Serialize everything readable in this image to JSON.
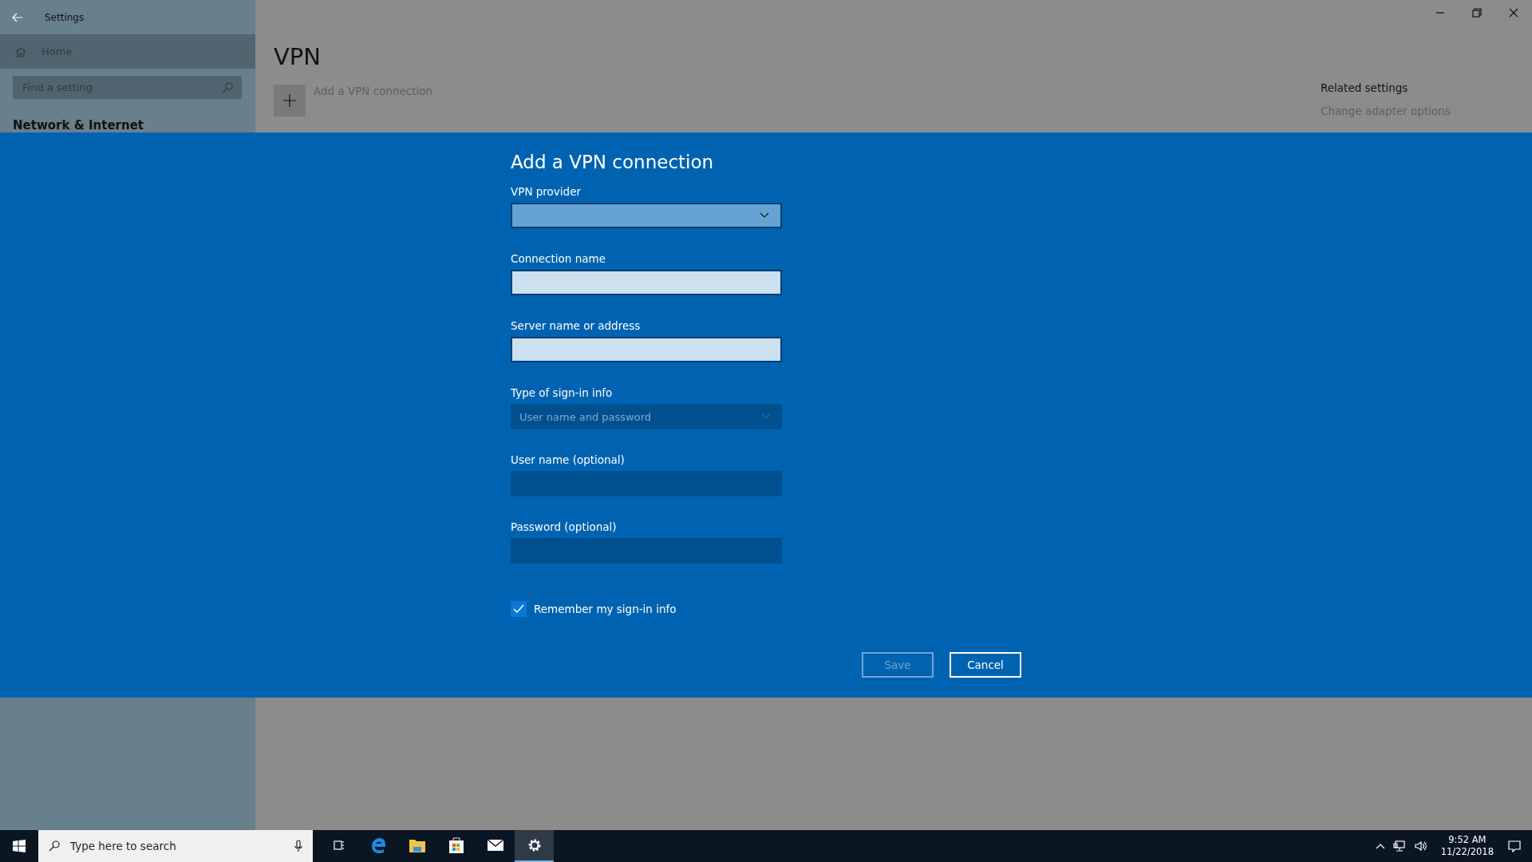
{
  "window": {
    "title": "Settings"
  },
  "sidebar": {
    "home": "Home",
    "search_placeholder": "Find a setting",
    "section": "Network & Internet"
  },
  "page": {
    "title": "VPN",
    "add_label": "Add a VPN connection",
    "related_title": "Related settings",
    "related_link": "Change adapter options"
  },
  "dialog": {
    "title": "Add a VPN connection",
    "fields": [
      {
        "kind": "dropdown",
        "label": "VPN provider",
        "disabled": false
      },
      {
        "kind": "text",
        "label": "Connection name",
        "disabled": false
      },
      {
        "kind": "text",
        "label": "Server name or address",
        "disabled": false
      },
      {
        "kind": "dropdown",
        "label": "Type of sign-in info",
        "value": "User name and password",
        "disabled": true
      },
      {
        "kind": "text",
        "label": "User name (optional)",
        "disabled": true
      },
      {
        "kind": "text",
        "label": "Password (optional)",
        "disabled": true
      }
    ],
    "remember": {
      "label": "Remember my sign-in info",
      "checked": true
    },
    "buttons": [
      {
        "label": "Save",
        "disabled": true
      },
      {
        "label": "Cancel",
        "disabled": false
      }
    ]
  },
  "taskbar": {
    "search_placeholder": "Type here to search",
    "apps": [
      {
        "kind": "taskview",
        "selected": false
      },
      {
        "kind": "edge",
        "selected": false
      },
      {
        "kind": "explorer",
        "selected": false
      },
      {
        "kind": "store",
        "selected": false
      },
      {
        "kind": "mail",
        "selected": false
      },
      {
        "kind": "settings",
        "selected": true
      }
    ],
    "time": "9:52 AM",
    "date": "11/22/2018"
  }
}
